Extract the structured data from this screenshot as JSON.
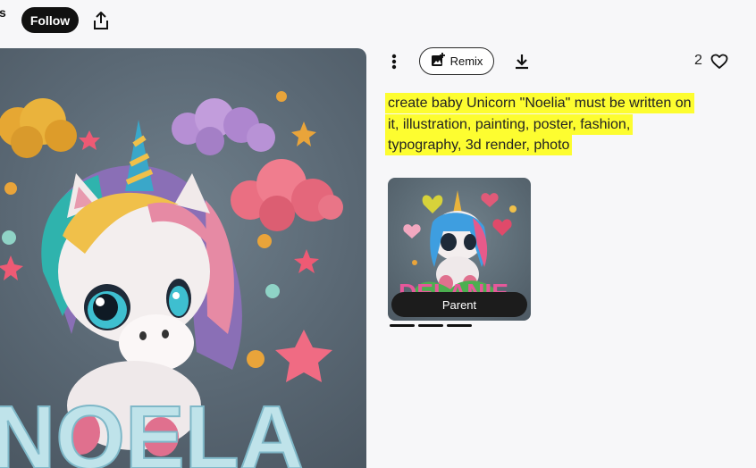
{
  "header": {
    "cut_text": "s",
    "follow_label": "Follow"
  },
  "toolbar": {
    "remix_label": "Remix",
    "like_count": "2"
  },
  "prompt": {
    "line1": "create baby Unicorn \"Noelia\" must be written on",
    "line2": "it, illustration, painting, poster, fashion,",
    "line3": "typography, 3d render, photo"
  },
  "parent_card": {
    "label": "Parent",
    "thumb_text": "DELANIE"
  },
  "main_image": {
    "text": "NOELA"
  },
  "icons": {
    "share": "share-icon",
    "more": "more-vertical-icon",
    "remix": "image-add-icon",
    "download": "download-icon",
    "heart": "heart-icon"
  },
  "carousel": {
    "indicator_count": 3
  }
}
